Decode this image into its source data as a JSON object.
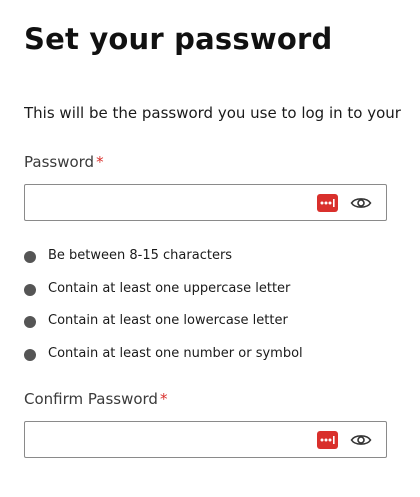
{
  "page": {
    "title": "Set your password",
    "intro": "This will be the password you use to log in to your"
  },
  "password_field": {
    "label": "Password",
    "required_marker": "*",
    "value": "",
    "password_manager_icon": "password-manager-icon",
    "toggle_icon": "eye-icon"
  },
  "requirements": [
    {
      "text": "Be between 8-15 characters",
      "status_icon": "bullet-dot-icon"
    },
    {
      "text": "Contain at least one uppercase letter",
      "status_icon": "bullet-dot-icon"
    },
    {
      "text": "Contain at least one lowercase letter",
      "status_icon": "bullet-dot-icon"
    },
    {
      "text": "Contain at least one number or symbol",
      "status_icon": "bullet-dot-icon"
    }
  ],
  "confirm_field": {
    "label": "Confirm Password",
    "required_marker": "*",
    "value": "",
    "password_manager_icon": "password-manager-icon",
    "toggle_icon": "eye-icon"
  },
  "colors": {
    "required": "#d9302c",
    "password_manager_badge": "#d9302c",
    "bullet": "#555555",
    "input_border": "#8a8a8a"
  }
}
